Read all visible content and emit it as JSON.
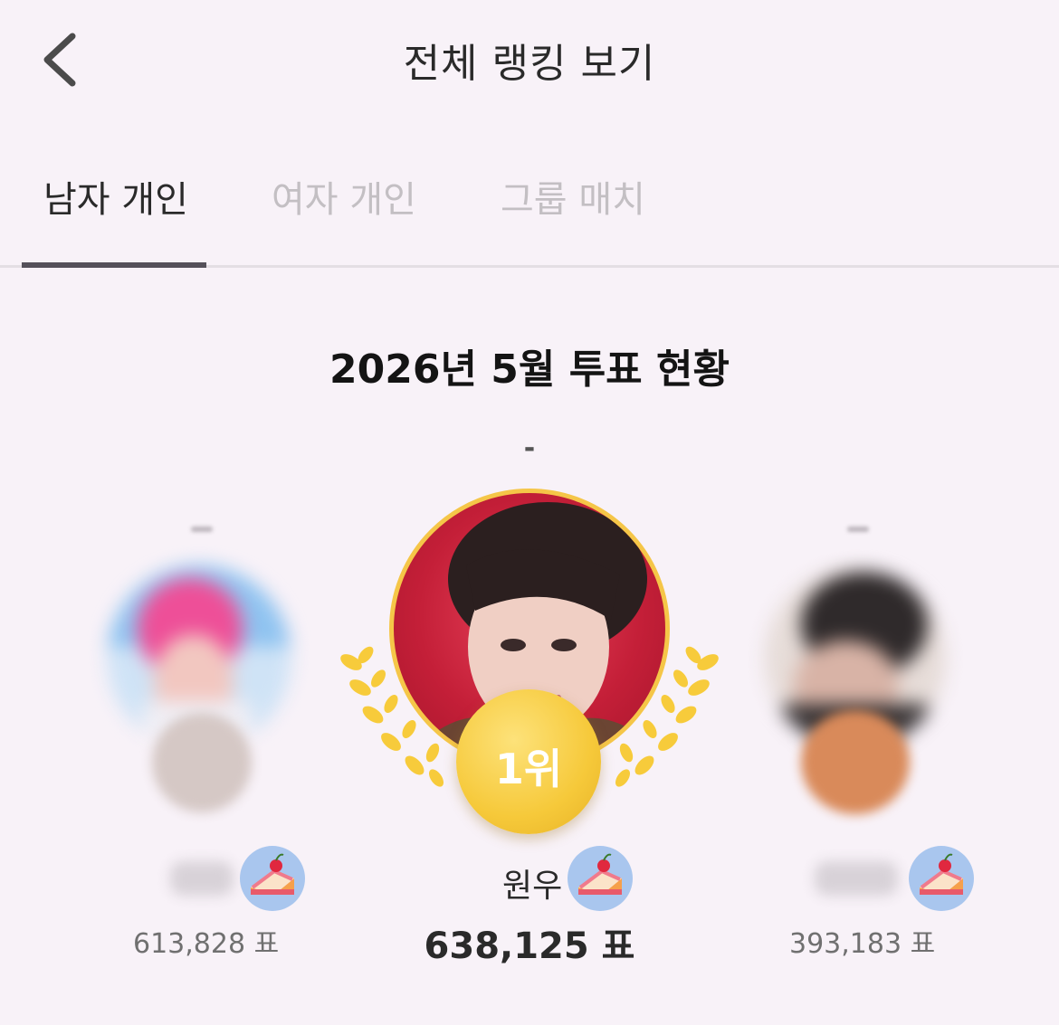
{
  "header": {
    "title": "전체 랭킹 보기"
  },
  "tabs": [
    {
      "label": "남자 개인",
      "active": true
    },
    {
      "label": "여자 개인",
      "active": false
    },
    {
      "label": "그룹 매치",
      "active": false
    }
  ],
  "board": {
    "heading": "2026년 5월 투표 현황",
    "first_rank_change": "-"
  },
  "podium": {
    "first": {
      "rank_label": "1위",
      "name": "원우",
      "votes": "638,125 표"
    },
    "second": {
      "votes": "613,828 표"
    },
    "third": {
      "votes": "393,183 표"
    }
  },
  "icons": {
    "back": "chevron-left-icon",
    "cake": "cake-icon",
    "laurel": "laurel-icon"
  },
  "colors": {
    "background": "#f8f2f8",
    "gold": "#f6c93a",
    "cake_badge": "#a9c6ee",
    "bronze": "#d98a5a",
    "silver": "#d5c8c5"
  }
}
